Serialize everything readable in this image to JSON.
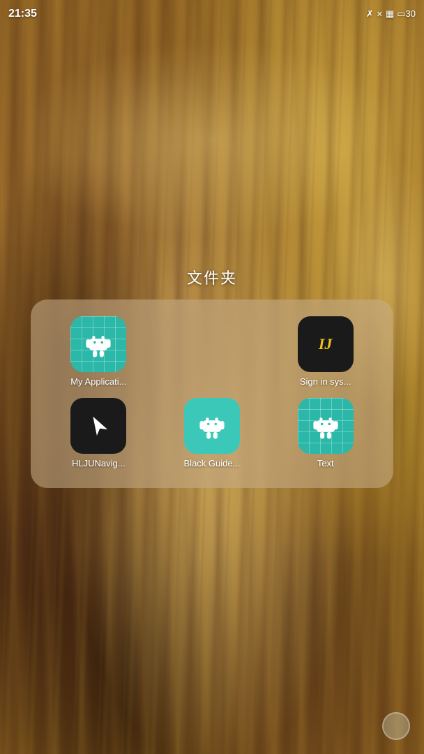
{
  "statusBar": {
    "time": "21:35",
    "batteryLevel": "30",
    "icons": [
      "bluetooth",
      "signal-off",
      "signal-bars",
      "battery"
    ]
  },
  "folder": {
    "title": "文件夹",
    "apps": [
      {
        "id": "my-application",
        "label": "My Applicati...",
        "iconType": "myapp",
        "row": 1,
        "col": 1
      },
      {
        "id": "sign-in-sys",
        "label": "Sign in sys...",
        "iconType": "signin",
        "row": 1,
        "col": 3
      },
      {
        "id": "hlju-navigate",
        "label": "HLJUNavig...",
        "iconType": "hlju",
        "row": 2,
        "col": 1
      },
      {
        "id": "black-guide",
        "label": "Black Guide...",
        "iconType": "blackguide",
        "row": 2,
        "col": 2
      },
      {
        "id": "text-app",
        "label": "Text",
        "iconType": "text",
        "row": 2,
        "col": 3
      }
    ]
  }
}
